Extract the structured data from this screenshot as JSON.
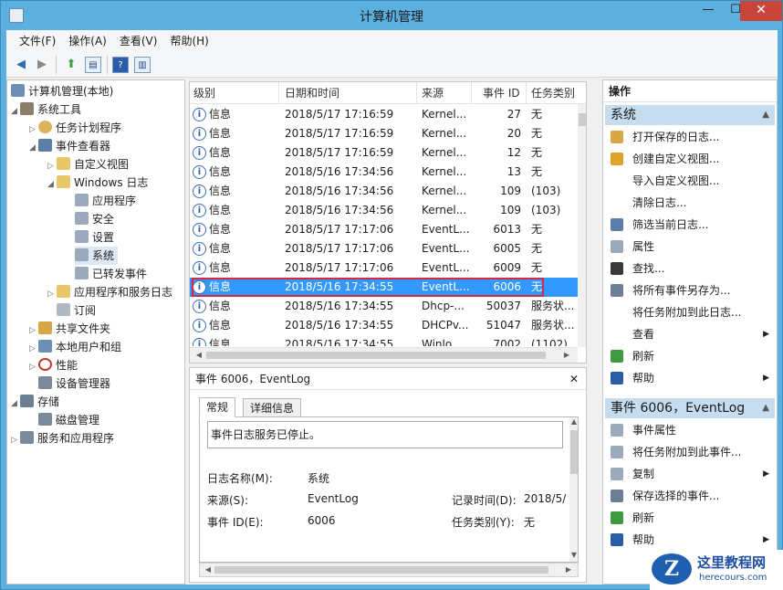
{
  "window": {
    "title": "计算机管理",
    "minimize": "—",
    "maximize": "☐",
    "close": "✕"
  },
  "menu": [
    "文件(F)",
    "操作(A)",
    "查看(V)",
    "帮助(H)"
  ],
  "tree": [
    {
      "label": "计算机管理(本地)",
      "icon_color": "#6d8fb5"
    },
    {
      "label": "系统工具",
      "icon_color": "#8a7d6a",
      "arrow": "◢"
    },
    {
      "label": "任务计划程序",
      "icon_color": "#d9b45a",
      "arrow": "▷"
    },
    {
      "label": "事件查看器",
      "icon_color": "#5a7fa8",
      "arrow": "◢"
    },
    {
      "label": "自定义视图",
      "icon_color": "#e8c76a",
      "arrow": "▷"
    },
    {
      "label": "Windows 日志",
      "icon_color": "#e8c76a",
      "arrow": "◢"
    },
    {
      "label": "应用程序",
      "icon_color": "#9aa9bc"
    },
    {
      "label": "安全",
      "icon_color": "#9aa9bc"
    },
    {
      "label": "设置",
      "icon_color": "#9aa9bc"
    },
    {
      "label": "系统",
      "icon_color": "#9aa9bc"
    },
    {
      "label": "已转发事件",
      "icon_color": "#9aa9bc"
    },
    {
      "label": "应用程序和服务日志",
      "icon_color": "#e8c76a",
      "arrow": "▷"
    },
    {
      "label": "订阅",
      "icon_color": "#b0b8c4"
    },
    {
      "label": "共享文件夹",
      "icon_color": "#d9a645",
      "arrow": "▷"
    },
    {
      "label": "本地用户和组",
      "icon_color": "#6d8fb5",
      "arrow": "▷"
    },
    {
      "label": "性能",
      "icon_color": "#c0392b",
      "arrow": "▷"
    },
    {
      "label": "设备管理器",
      "icon_color": "#7a8a9a"
    },
    {
      "label": "存储",
      "icon_color": "#6d7f94",
      "arrow": "◢"
    },
    {
      "label": "磁盘管理",
      "icon_color": "#7a8a9a"
    },
    {
      "label": "服务和应用程序",
      "icon_color": "#7a8a9a",
      "arrow": "▷"
    }
  ],
  "list": {
    "headers": [
      "级别",
      "日期和时间",
      "来源",
      "事件 ID",
      "任务类别"
    ],
    "rows": [
      [
        "信息",
        "2018/5/17 17:16:59",
        "Kernel...",
        "27",
        "无"
      ],
      [
        "信息",
        "2018/5/17 17:16:59",
        "Kernel...",
        "20",
        "无"
      ],
      [
        "信息",
        "2018/5/17 17:16:59",
        "Kernel...",
        "12",
        "无"
      ],
      [
        "信息",
        "2018/5/16 17:34:56",
        "Kernel...",
        "13",
        "无"
      ],
      [
        "信息",
        "2018/5/16 17:34:56",
        "Kernel...",
        "109",
        "(103)"
      ],
      [
        "信息",
        "2018/5/16 17:34:56",
        "Kernel...",
        "109",
        "(103)"
      ],
      [
        "信息",
        "2018/5/17 17:17:06",
        "EventL...",
        "6013",
        "无"
      ],
      [
        "信息",
        "2018/5/17 17:17:06",
        "EventL...",
        "6005",
        "无"
      ],
      [
        "信息",
        "2018/5/17 17:17:06",
        "EventL...",
        "6009",
        "无"
      ],
      [
        "信息",
        "2018/5/16 17:34:55",
        "EventL...",
        "6006",
        "无"
      ],
      [
        "信息",
        "2018/5/16 17:34:55",
        "Dhcp-...",
        "50037",
        "服务状..."
      ],
      [
        "信息",
        "2018/5/16 17:34:55",
        "DHCPv...",
        "51047",
        "服务状..."
      ],
      [
        "信息",
        "2018/5/16 17:34:55",
        "Winlo...",
        "7002",
        "(1102)"
      ]
    ]
  },
  "detail": {
    "header": "事件 6006，EventLog",
    "close": "✕",
    "tabs": [
      "常规",
      "详细信息"
    ],
    "message": "事件日志服务已停止。",
    "fields": {
      "log_name_label": "日志名称(M):",
      "log_name_value": "系统",
      "source_label": "来源(S):",
      "source_value": "EventLog",
      "recorded_label": "记录时间(D):",
      "recorded_value": "2018/5/",
      "event_id_label": "事件 ID(E):",
      "event_id_value": "6006",
      "task_label": "任务类别(Y):",
      "task_value": "无"
    }
  },
  "actions": {
    "title": "操作",
    "section1": "系统",
    "items1": [
      {
        "label": "打开保存的日志...",
        "icon_color": "#d9a645"
      },
      {
        "label": "创建自定义视图...",
        "icon_color": "#e0a32e"
      },
      {
        "label": "导入自定义视图...",
        "icon_color": "#ffffff"
      },
      {
        "label": "清除日志...",
        "icon_color": "#ffffff"
      },
      {
        "label": "筛选当前日志...",
        "icon_color": "#5a7fa8"
      },
      {
        "label": "属性",
        "icon_color": "#9aa9bc"
      },
      {
        "label": "查找...",
        "icon_color": "#3a3a3a"
      },
      {
        "label": "将所有事件另存为...",
        "icon_color": "#6d7f94"
      },
      {
        "label": "将任务附加到此日志...",
        "icon_color": "#ffffff"
      },
      {
        "label": "查看",
        "icon_color": "#ffffff",
        "submenu": "▶"
      },
      {
        "label": "刷新",
        "icon_color": "#3f9a3f"
      },
      {
        "label": "帮助",
        "icon_color": "#2a5ca8",
        "submenu": "▶"
      }
    ],
    "section2": "事件 6006，EventLog",
    "items2": [
      {
        "label": "事件属性",
        "icon_color": "#9aa9bc"
      },
      {
        "label": "将任务附加到此事件...",
        "icon_color": "#9aa9bc"
      },
      {
        "label": "复制",
        "icon_color": "#9aa9bc",
        "submenu": "▶"
      },
      {
        "label": "保存选择的事件...",
        "icon_color": "#6d7f94"
      },
      {
        "label": "刷新",
        "icon_color": "#3f9a3f"
      },
      {
        "label": "帮助",
        "icon_color": "#2a5ca8",
        "submenu": "▶"
      }
    ]
  },
  "watermark": {
    "logo": "Z",
    "title": "这里教程网",
    "url": "herecours.com"
  }
}
